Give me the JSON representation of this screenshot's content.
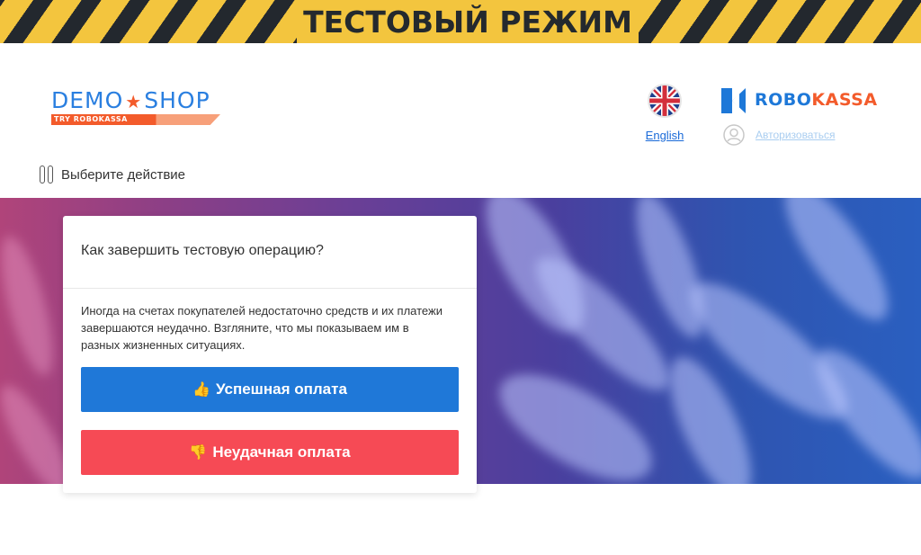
{
  "banner": {
    "text": "ТЕСТОВЫЙ РЕЖИМ"
  },
  "shop_logo": {
    "name": "DEMO★SHOP",
    "tagline": "TRY ROBOKASSA"
  },
  "language": {
    "label": "English",
    "flag_icon": "uk-flag-icon"
  },
  "payment_provider": {
    "brand_part1": "ROBO",
    "brand_part2": "KASSA"
  },
  "login": {
    "label": "Авторизоваться",
    "icon": "user-icon"
  },
  "action_menu": {
    "label": "Выберите действие",
    "icon": "pause-icon"
  },
  "card": {
    "title": "Как завершить тестовую операцию?",
    "description": "Иногда на счетах покупателей недостаточно средств и их платежи завершаются неудачно. Взгляните, что мы показываем им в разных жизненных ситуациях.",
    "success_button": {
      "label": "Успешная оплата",
      "icon": "thumbs-up-icon",
      "emoji": "👍",
      "color": "#1f78d8"
    },
    "fail_button": {
      "label": "Неудачная оплата",
      "icon": "thumbs-down-icon",
      "emoji": "👎",
      "color": "#f64a55"
    }
  },
  "colors": {
    "accent_blue": "#1f78d8",
    "accent_orange": "#f35b2b",
    "danger": "#f64a55",
    "banner_yellow": "#f3c53e"
  }
}
